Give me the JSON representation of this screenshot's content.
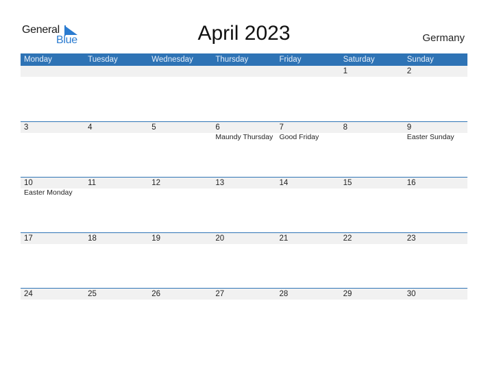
{
  "logo": {
    "line1": "General",
    "line2": "Blue"
  },
  "title": "April 2023",
  "country": "Germany",
  "colors": {
    "header": "#2e73b5",
    "strip": "#f1f1f1",
    "logo_blue": "#2a7bd0"
  },
  "weekdays": [
    "Monday",
    "Tuesday",
    "Wednesday",
    "Thursday",
    "Friday",
    "Saturday",
    "Sunday"
  ],
  "weeks": [
    {
      "days": [
        {
          "n": "",
          "h": ""
        },
        {
          "n": "",
          "h": ""
        },
        {
          "n": "",
          "h": ""
        },
        {
          "n": "",
          "h": ""
        },
        {
          "n": "",
          "h": ""
        },
        {
          "n": "1",
          "h": ""
        },
        {
          "n": "2",
          "h": ""
        }
      ]
    },
    {
      "days": [
        {
          "n": "3",
          "h": ""
        },
        {
          "n": "4",
          "h": ""
        },
        {
          "n": "5",
          "h": ""
        },
        {
          "n": "6",
          "h": "Maundy Thursday"
        },
        {
          "n": "7",
          "h": "Good Friday"
        },
        {
          "n": "8",
          "h": ""
        },
        {
          "n": "9",
          "h": "Easter Sunday"
        }
      ]
    },
    {
      "days": [
        {
          "n": "10",
          "h": "Easter Monday"
        },
        {
          "n": "11",
          "h": ""
        },
        {
          "n": "12",
          "h": ""
        },
        {
          "n": "13",
          "h": ""
        },
        {
          "n": "14",
          "h": ""
        },
        {
          "n": "15",
          "h": ""
        },
        {
          "n": "16",
          "h": ""
        }
      ]
    },
    {
      "days": [
        {
          "n": "17",
          "h": ""
        },
        {
          "n": "18",
          "h": ""
        },
        {
          "n": "19",
          "h": ""
        },
        {
          "n": "20",
          "h": ""
        },
        {
          "n": "21",
          "h": ""
        },
        {
          "n": "22",
          "h": ""
        },
        {
          "n": "23",
          "h": ""
        }
      ]
    },
    {
      "days": [
        {
          "n": "24",
          "h": ""
        },
        {
          "n": "25",
          "h": ""
        },
        {
          "n": "26",
          "h": ""
        },
        {
          "n": "27",
          "h": ""
        },
        {
          "n": "28",
          "h": ""
        },
        {
          "n": "29",
          "h": ""
        },
        {
          "n": "30",
          "h": ""
        }
      ]
    }
  ]
}
